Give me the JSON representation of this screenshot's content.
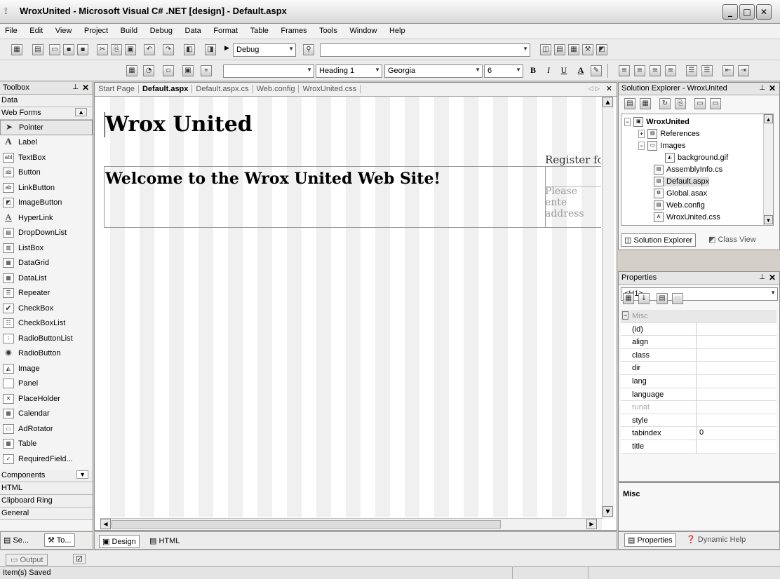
{
  "window": {
    "title": "WroxUnited - Microsoft Visual C# .NET [design] - Default.aspx",
    "minimize": "_",
    "maximize": "□",
    "close": "✕"
  },
  "menu": {
    "items": [
      "File",
      "Edit",
      "View",
      "Project",
      "Build",
      "Debug",
      "Data",
      "Format",
      "Table",
      "Frames",
      "Tools",
      "Window",
      "Help"
    ]
  },
  "toolbar": {
    "config": "Debug",
    "block_format": "Heading 1",
    "font_name": "Georgia",
    "font_size": "6",
    "bold": "B",
    "italic": "I",
    "underline": "U"
  },
  "toolbox": {
    "title": "Toolbox",
    "categories_top": [
      "Data",
      "Web Forms"
    ],
    "items": [
      "Pointer",
      "Label",
      "TextBox",
      "Button",
      "LinkButton",
      "ImageButton",
      "HyperLink",
      "DropDownList",
      "ListBox",
      "DataGrid",
      "DataList",
      "Repeater",
      "CheckBox",
      "CheckBoxList",
      "RadioButtonList",
      "RadioButton",
      "Image",
      "Panel",
      "PlaceHolder",
      "Calendar",
      "AdRotator",
      "Table",
      "RequiredField..."
    ],
    "categories_bottom": [
      "Components",
      "HTML",
      "Clipboard Ring",
      "General"
    ],
    "bottom_tabs": [
      "Se...",
      "To..."
    ]
  },
  "editor": {
    "tabs": [
      "Start Page",
      "Default.aspx",
      "Default.aspx.cs",
      "Web.config",
      "WroxUnited.css"
    ],
    "heading": "Wrox United",
    "welcome": "Welcome to the Wrox United Web Site!",
    "register": "Register fo",
    "please": "Please ente address",
    "view_tabs": [
      "Design",
      "HTML"
    ]
  },
  "solution_explorer": {
    "title": "Solution Explorer - WroxUnited",
    "project": "WroxUnited",
    "nodes": [
      "References",
      "Images",
      "background.gif",
      "AssemblyInfo.cs",
      "Default.aspx",
      "Global.asax",
      "Web.config",
      "WroxUnited.css"
    ],
    "tabs": [
      "Solution Explorer",
      "Class View"
    ]
  },
  "properties": {
    "title": "Properties",
    "object": "<H1>",
    "category": "Misc",
    "rows": [
      {
        "name": "(id)",
        "value": ""
      },
      {
        "name": "align",
        "value": ""
      },
      {
        "name": "class",
        "value": ""
      },
      {
        "name": "dir",
        "value": ""
      },
      {
        "name": "lang",
        "value": ""
      },
      {
        "name": "language",
        "value": ""
      },
      {
        "name": "runat",
        "value": ""
      },
      {
        "name": "style",
        "value": ""
      },
      {
        "name": "tabindex",
        "value": "0"
      },
      {
        "name": "title",
        "value": ""
      }
    ],
    "description": "Misc",
    "tabs": [
      "Properties",
      "Dynamic Help"
    ]
  },
  "output": {
    "label": "Output"
  },
  "status": {
    "text": "Item(s) Saved"
  }
}
